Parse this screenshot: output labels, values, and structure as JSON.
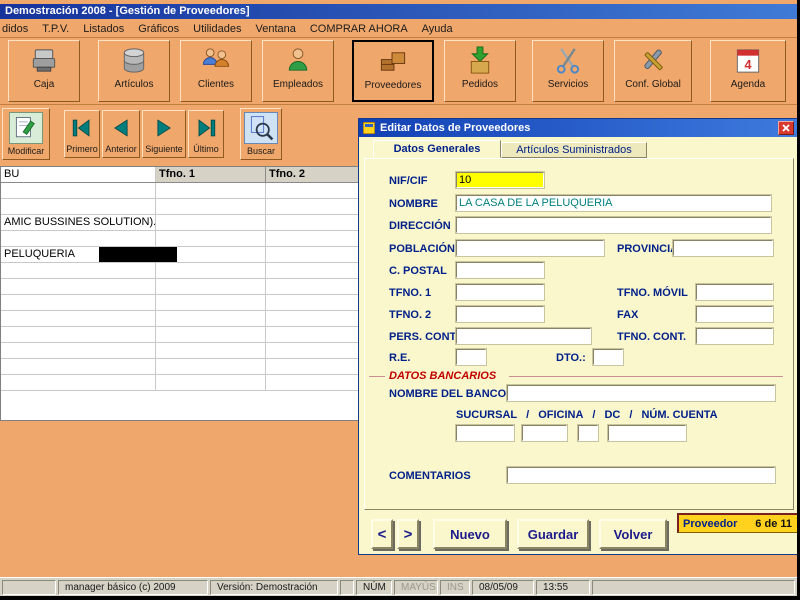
{
  "colors": {
    "window_bg": "#F0A76B",
    "titlebar_blue_start": "#16339B",
    "titlebar_blue_end": "#3F7BD6",
    "dialog_bg": "#FBF7CC",
    "highlight_field": "#FFFF00",
    "value_text": "#008080",
    "label_text": "#00208A",
    "bancarios_red": "#C00000",
    "record_bg": "#FFD21E",
    "statusbar_bg": "#D6D2C6"
  },
  "window": {
    "title": "Demostración 2008 - [Gestión de Proveedores]"
  },
  "menu": {
    "items": [
      {
        "label": "didos"
      },
      {
        "label": "T.P.V."
      },
      {
        "label": "Listados"
      },
      {
        "label": "Gráficos"
      },
      {
        "label": "Utilidades"
      },
      {
        "label": "Ventana"
      },
      {
        "label": "COMPRAR AHORA"
      },
      {
        "label": "Ayuda"
      }
    ]
  },
  "toolbar": {
    "buttons": [
      {
        "label": "Caja",
        "icon": "cash-register-icon"
      },
      {
        "label": "Artículos",
        "icon": "stock-discs-icon"
      },
      {
        "label": "Clientes",
        "icon": "clients-people-icon"
      },
      {
        "label": "Empleados",
        "icon": "employee-person-icon"
      },
      {
        "label": "Proveedores",
        "icon": "supplier-boxes-icon",
        "selected": true
      },
      {
        "label": "Pedidos",
        "icon": "orders-box-arrow-icon"
      },
      {
        "label": "Servicios",
        "icon": "scissors-icon"
      },
      {
        "label": "Conf. Global",
        "icon": "tools-icon"
      },
      {
        "label": "Agenda",
        "icon": "calendar-icon"
      }
    ]
  },
  "navbar": {
    "modificar": "Modificar",
    "primero": "Primero",
    "anterior": "Anterior",
    "siguiente": "Siguiente",
    "ultimo": "Último",
    "buscar": "Buscar"
  },
  "grid": {
    "header": {
      "col0": "BU",
      "col1": "Tfno. 1",
      "col2": "Tfno. 2"
    },
    "rows": [
      "",
      "",
      "AMIC BUSSINES SOLUTION).",
      "",
      "PELUQUERIA",
      "",
      "",
      "",
      "",
      "",
      "",
      "",
      ""
    ],
    "selected_row_index": 4
  },
  "dialog": {
    "title": "Editar Datos de Proveedores",
    "tabs": [
      {
        "label": "Datos Generales",
        "active": true
      },
      {
        "label": "Artículos Suministrados",
        "active": false
      }
    ],
    "fields": {
      "nif_label": "NIF/CIF",
      "nif_value": "10",
      "nombre_label": "NOMBRE",
      "nombre_value": "LA CASA DE LA PELUQUERIA",
      "direccion_label": "DIRECCIÓN",
      "direccion_value": "",
      "poblacion_label": "POBLACIÓN",
      "poblacion_value": "",
      "provincia_label": "PROVINCIA",
      "provincia_value": "",
      "cpostal_label": "C. POSTAL",
      "cpostal_value": "",
      "tfno1_label": "TFNO. 1",
      "tfno1_value": "",
      "movil_label": "TFNO. MÓVIL",
      "movil_value": "",
      "tfno2_label": "TFNO. 2",
      "tfno2_value": "",
      "fax_label": "FAX",
      "fax_value": "",
      "pers_label": "PERS. CONT.",
      "pers_value": "",
      "tfnocont_label": "TFNO. CONT.",
      "tfnocont_value": "",
      "re_label": "R.E.",
      "re_value": "",
      "dto_label": "DTO.:",
      "dto_value": "",
      "bancarios_title": "DATOS BANCARIOS",
      "banco_label": "NOMBRE DEL BANCO",
      "banco_value": "",
      "sucursal_label": "SUCURSAL",
      "oficina_label": "OFICINA",
      "dc_label": "DC",
      "cuenta_label": "NÚM. CUENTA",
      "sep": "/",
      "sucursal_value": "",
      "oficina_value": "",
      "dc_value": "",
      "cuenta_value": "",
      "comentarios_label": "COMENTARIOS",
      "comentarios_value": ""
    },
    "buttons": {
      "prev": "<",
      "next": ">",
      "nuevo": "Nuevo",
      "guardar": "Guardar",
      "volver": "Volver"
    },
    "record": {
      "label": "Proveedor",
      "position": "6 de 11"
    }
  },
  "statusbar": {
    "app": "manager básico (c) 2009",
    "version": "Versión: Demostración",
    "num": "NÚM",
    "mayus": "MAYÚS",
    "ins": "INS",
    "date": "08/05/09",
    "time": "13:55"
  }
}
